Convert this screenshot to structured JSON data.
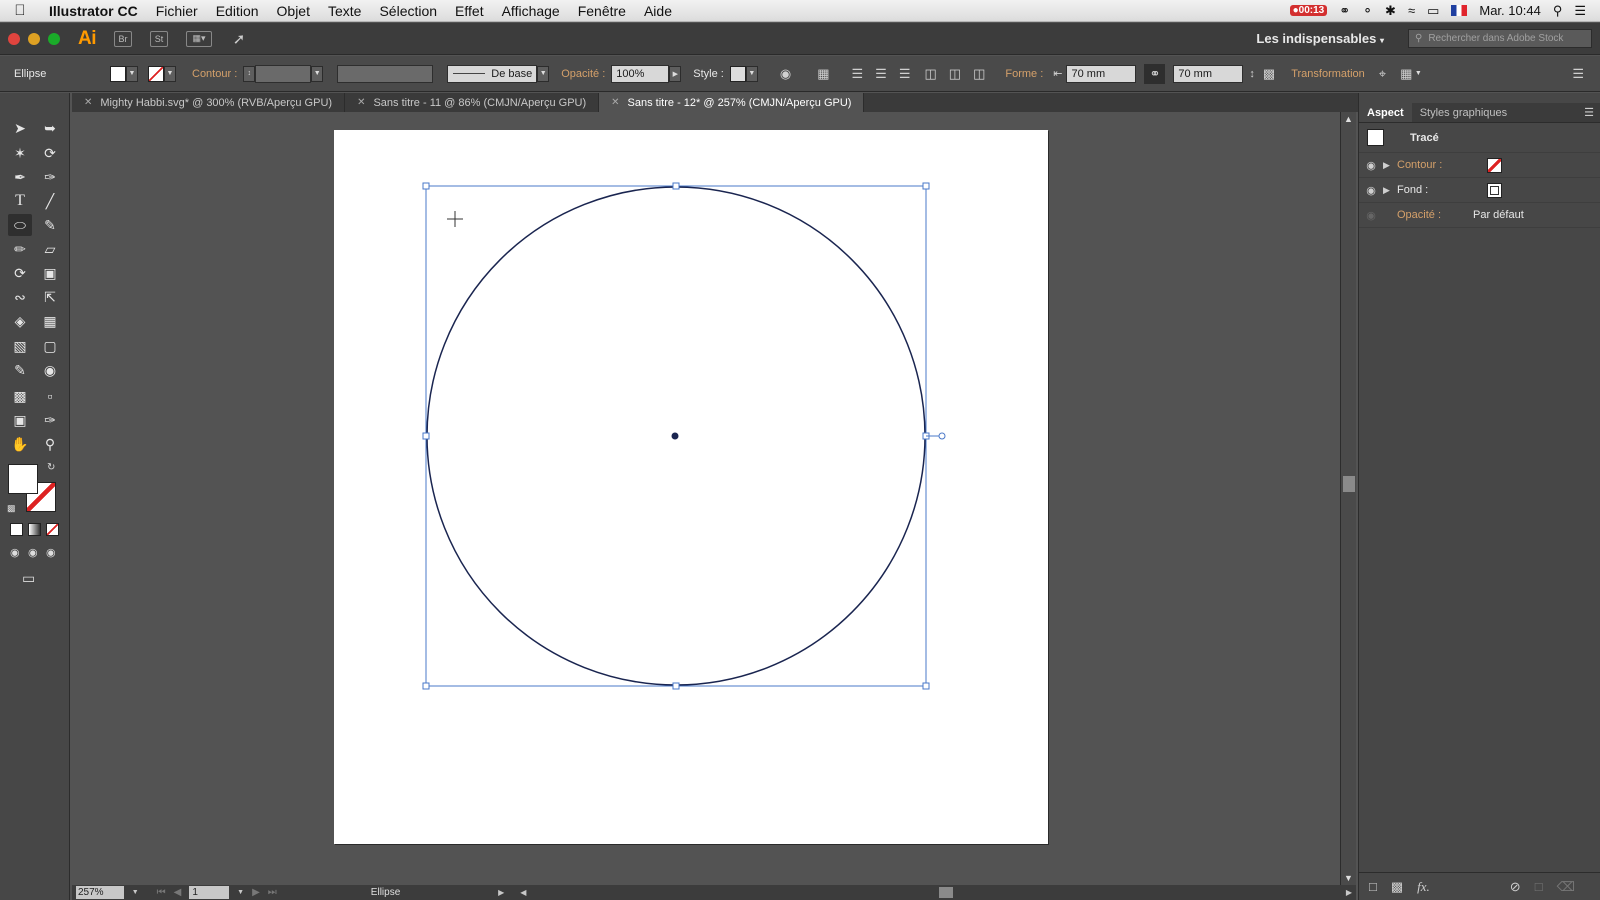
{
  "menubar": {
    "app_name": "Illustrator CC",
    "menus": [
      "Fichier",
      "Edition",
      "Objet",
      "Texte",
      "Sélection",
      "Effet",
      "Affichage",
      "Fenêtre",
      "Aide"
    ],
    "recording_time": "00:13",
    "clock": "Mar. 10:44"
  },
  "appbar": {
    "logo": "Ai",
    "bridge_label": "Br",
    "stock_label": "St",
    "workspace": "Les indispensables",
    "stock_search_placeholder": "Rechercher dans Adobe Stock"
  },
  "control": {
    "selection_type": "Ellipse",
    "stroke_label": "Contour :",
    "brush_label": "De base",
    "opacity_label": "Opacité :",
    "opacity_value": "100%",
    "style_label": "Style :",
    "shape_label": "Forme :",
    "width_value": "70 mm",
    "height_value": "70 mm",
    "transform_label": "Transformation"
  },
  "tabs": [
    {
      "label": "Mighty Habbi.svg* @ 300% (RVB/Aperçu GPU)"
    },
    {
      "label": "Sans titre - 11 @ 86% (CMJN/Aperçu GPU)"
    },
    {
      "label": "Sans titre - 12* @ 257% (CMJN/Aperçu GPU)"
    }
  ],
  "status": {
    "zoom": "257%",
    "page": "1",
    "tool_name": "Ellipse"
  },
  "panel": {
    "tabs": [
      "Aspect",
      "Styles graphiques"
    ],
    "object_label": "Tracé",
    "stroke_label": "Contour :",
    "fill_label": "Fond :",
    "opacity_label": "Opacité :",
    "opacity_value": "Par défaut",
    "fx_label": "fx."
  },
  "colors": {
    "accent_label": "#d4a06a",
    "selection": "#4a78c8",
    "path": "#1a2550",
    "ai_logo": "#ff9a00"
  }
}
